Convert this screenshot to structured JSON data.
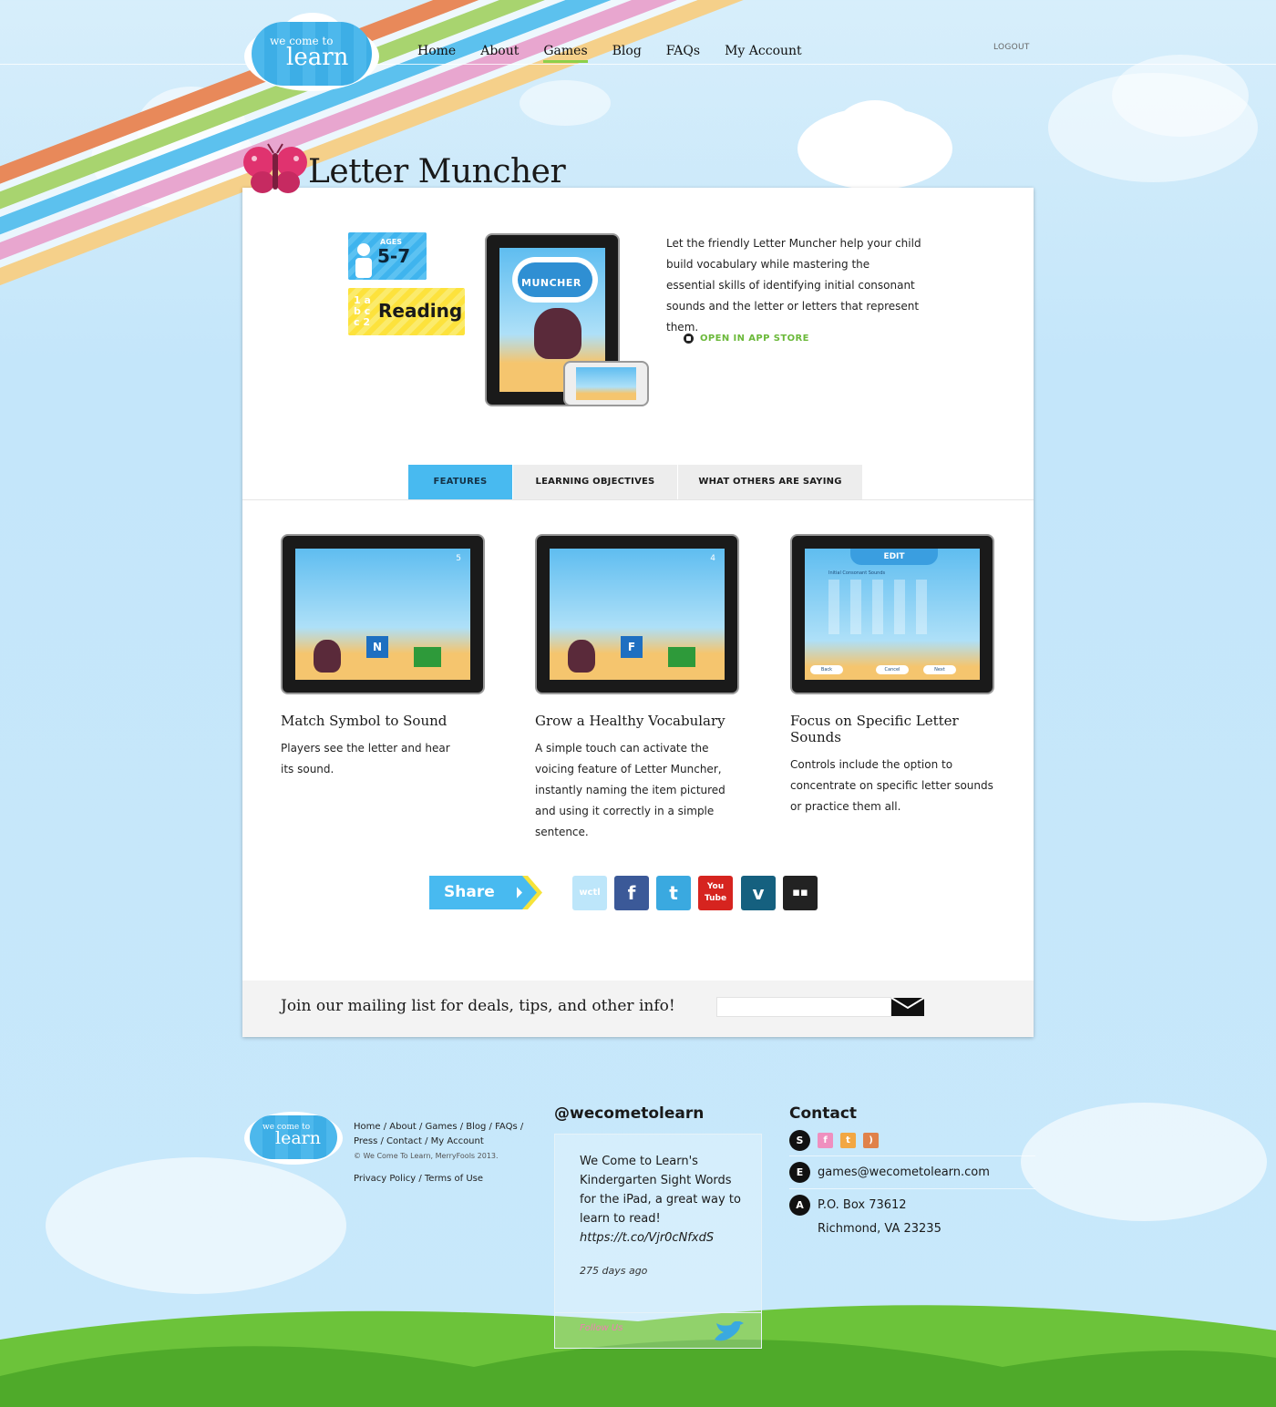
{
  "header": {
    "logo_line1": "we come to",
    "logo_line2": "learn",
    "nav": [
      "Home",
      "About",
      "Games",
      "Blog",
      "FAQs",
      "My Account"
    ],
    "active_nav": "Games",
    "logout": "LOGOUT"
  },
  "game": {
    "title": "Letter Muncher",
    "age_label": "AGES",
    "age_value": "5-7",
    "subject": "Reading",
    "screen_title": "MUNCHER",
    "description": "Let the friendly Letter Muncher help your child build vocabulary while mastering the essential skills of identifying initial consonant sounds and the letter or letters that represent them.",
    "app_store": "OPEN IN APP STORE"
  },
  "tabs": [
    "FEATURES",
    "LEARNING OBJECTIVES",
    "WHAT OTHERS ARE SAYING"
  ],
  "features": [
    {
      "title": "Match Symbol to Sound",
      "text": "Players see the letter and hear its sound.",
      "letter": "N",
      "hud": "5"
    },
    {
      "title": "Grow a Healthy Vocabulary",
      "text": "A simple touch can activate the voicing feature of Letter Muncher, instantly naming the item pictured and using it correctly in a simple sentence.",
      "letter": "F",
      "hud": "4"
    },
    {
      "title": "Focus on Specific Letter Sounds",
      "text": "Controls include the option to concentrate on specific letter sounds or practice them all.",
      "screen_title": "EDIT",
      "screen_sub": "Initial Consonant Sounds",
      "buttons": [
        "Back",
        "Cancel",
        "Next"
      ]
    }
  ],
  "share": {
    "label": "Share",
    "icons": [
      "wctl-icon",
      "facebook-icon",
      "twitter-icon",
      "youtube-icon",
      "vimeo-icon",
      "video-camera-icon"
    ],
    "icon_labels": [
      "wctl",
      "f",
      "t",
      "You Tube",
      "v",
      "▪▪"
    ]
  },
  "mailing": {
    "text": "Join our mailing list for deals, tips, and other info!",
    "input_value": ""
  },
  "footer": {
    "links_line1": "Home / About / Games / Blog / FAQs /",
    "links_line2": "Press / Contact / My Account",
    "copyright": "© We Come To Learn, MerryFools 2013.",
    "privacy": "Privacy Policy / Terms of Use",
    "twitter_handle": "@wecometolearn",
    "tweet": "We Come to Learn's Kindergarten Sight Words for the iPad, a great way to learn to read!",
    "tweet_link": "https://t.co/Vjr0cNfxdS",
    "tweet_time": "275 days ago",
    "follow": "Follow Us",
    "contact_heading": "Contact",
    "social_bullet": "S",
    "email_bullet": "E",
    "address_bullet": "A",
    "email": "games@wecometolearn.com",
    "address_line1": "P.O. Box 73612",
    "address_line2": "Richmond, VA 23235"
  },
  "colors": {
    "accent_blue": "#48baf0",
    "nav_underline": "#8cd04a",
    "app_store_green": "#6bb93a",
    "rainbow": [
      "#e8895a",
      "#a8d46f",
      "#5cc1ee",
      "#e8a6cf",
      "#f5d08a"
    ]
  }
}
